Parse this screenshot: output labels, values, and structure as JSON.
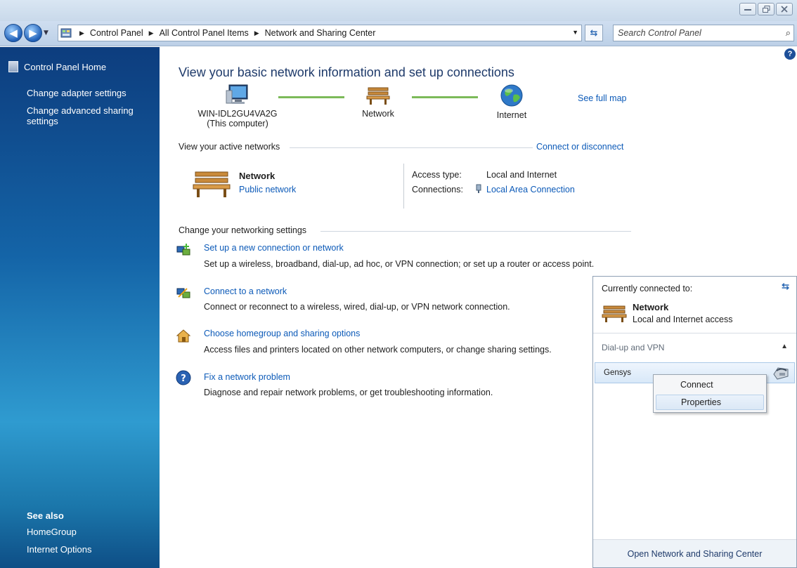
{
  "window": {
    "min_label": "▭",
    "max_label": "🗗",
    "close_label": "✕"
  },
  "address": {
    "crumbs": [
      "Control Panel",
      "All Control Panel Items",
      "Network and Sharing Center"
    ]
  },
  "search": {
    "placeholder": "Search Control Panel"
  },
  "sidebar": {
    "home": "Control Panel Home",
    "links": [
      "Change adapter settings",
      "Change advanced sharing settings"
    ],
    "see_also_title": "See also",
    "see_also": [
      "HomeGroup",
      "Internet Options"
    ]
  },
  "main": {
    "title": "View your basic network information and set up connections",
    "map": {
      "computer_name": "WIN-IDL2GU4VA2G",
      "computer_sub": "(This computer)",
      "network_label": "Network",
      "internet_label": "Internet",
      "see_full_map": "See full map"
    },
    "active_networks": {
      "heading": "View your active networks",
      "connect_link": "Connect or disconnect",
      "network_name": "Network",
      "network_type": "Public network",
      "access_type_label": "Access type:",
      "access_type_value": "Local and Internet",
      "connections_label": "Connections:",
      "connections_value": "Local Area Connection"
    },
    "settings": {
      "heading": "Change your networking settings",
      "tasks": [
        {
          "title": "Set up a new connection or network",
          "desc": "Set up a wireless, broadband, dial-up, ad hoc, or VPN connection; or set up a router or access point."
        },
        {
          "title": "Connect to a network",
          "desc": "Connect or reconnect to a wireless, wired, dial-up, or VPN network connection."
        },
        {
          "title": "Choose homegroup and sharing options",
          "desc": "Access files and printers located on other network computers, or change sharing settings."
        },
        {
          "title": "Fix a network problem",
          "desc": "Diagnose and repair network problems, or get troubleshooting information."
        }
      ]
    }
  },
  "flyout": {
    "heading": "Currently connected to:",
    "network_name": "Network",
    "network_status": "Local and Internet access",
    "section": "Dial-up and VPN",
    "connection": "Gensys",
    "footer": "Open Network and Sharing Center"
  },
  "context_menu": {
    "items": [
      "Connect",
      "Properties"
    ]
  }
}
